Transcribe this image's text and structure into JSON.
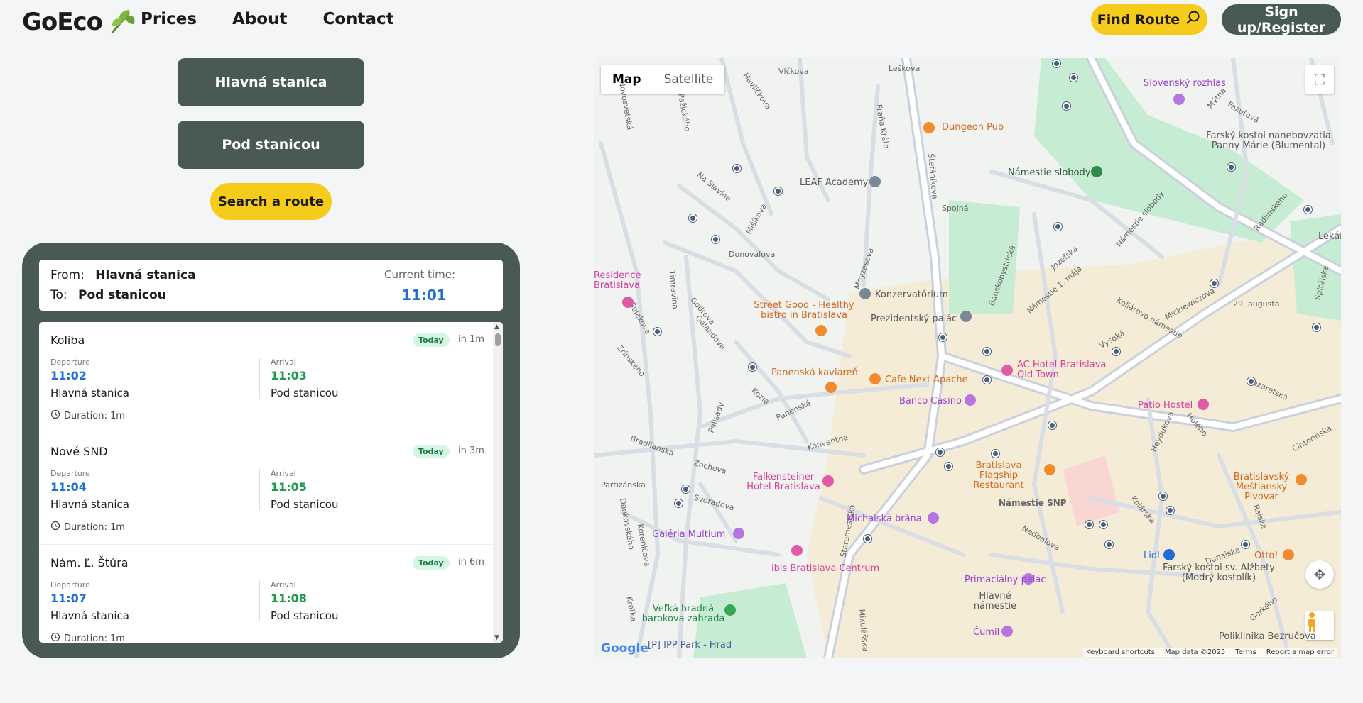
{
  "header": {
    "logo": "GoEco",
    "nav": [
      "Prices",
      "About",
      "Contact"
    ],
    "find_route": "Find Route",
    "signup": "Sign up/Register"
  },
  "route": {
    "from_button": "Hlavná stanica",
    "to_button": "Pod stanicou",
    "search_button": "Search a route"
  },
  "info": {
    "from_label": "From:",
    "from_value": "Hlavná stanica",
    "to_label": "To:",
    "to_value": "Pod stanicou",
    "current_time_label": "Current time:",
    "current_time": "11:01"
  },
  "departures": [
    {
      "line": "Koliba",
      "badge": "Today",
      "eta": "in 1m",
      "dep_label": "Departure",
      "dep_time": "11:02",
      "dep_stop": "Hlavná stanica",
      "arr_label": "Arrival",
      "arr_time": "11:03",
      "arr_stop": "Pod stanicou",
      "duration": "Duration: 1m"
    },
    {
      "line": "Nové SND",
      "badge": "Today",
      "eta": "in 3m",
      "dep_label": "Departure",
      "dep_time": "11:04",
      "dep_stop": "Hlavná stanica",
      "arr_label": "Arrival",
      "arr_time": "11:05",
      "arr_stop": "Pod stanicou",
      "duration": "Duration: 1m"
    },
    {
      "line": "Nám. Ľ. Štúra",
      "badge": "Today",
      "eta": "in 6m",
      "dep_label": "Departure",
      "dep_time": "11:07",
      "dep_stop": "Hlavná stanica",
      "arr_label": "Arrival",
      "arr_time": "11:08",
      "arr_stop": "Pod stanicou",
      "duration": "Duration: 1m"
    }
  ],
  "map": {
    "type_map": "Map",
    "type_satellite": "Satellite",
    "google": "Google",
    "attribution": [
      "Keyboard shortcuts",
      "Map data ©2025",
      "Terms",
      "Report a map error"
    ],
    "places": [
      {
        "name": "Slovenský rozhlas",
        "color": "#9b3fcf"
      },
      {
        "name": "Dungeon Pub",
        "color": "#d2691e"
      },
      {
        "name": "Námestie slobody",
        "color": "#2e5a3a"
      },
      {
        "name": "LEAF Academy",
        "color": "#555555"
      },
      {
        "name": "Farský kostol nanebovzatia Panny Márie (Blumental)",
        "color": "#555555"
      },
      {
        "name": "Residence Bratislava",
        "color": "#d63c9c"
      },
      {
        "name": "Konzervatórium",
        "color": "#555555"
      },
      {
        "name": "Street Good - Healthy bistro in Bratislava",
        "color": "#d2691e"
      },
      {
        "name": "Prezidentský palác",
        "color": "#555555"
      },
      {
        "name": "Panenská kaviareň",
        "color": "#d2691e"
      },
      {
        "name": "Cafe Next Apache",
        "color": "#d2691e"
      },
      {
        "name": "AC Hotel Bratislava Old Town",
        "color": "#d63c9c"
      },
      {
        "name": "Banco Casino",
        "color": "#9b3fcf"
      },
      {
        "name": "Patio Hostel",
        "color": "#d63c9c"
      },
      {
        "name": "Bratislava Flagship Restaurant",
        "color": "#d2691e"
      },
      {
        "name": "Falkensteiner Hotel Bratislava",
        "color": "#d63c9c"
      },
      {
        "name": "Bratislavský Meštiansky Pivovar",
        "color": "#d2691e"
      },
      {
        "name": "Michalská brána",
        "color": "#9b3fcf"
      },
      {
        "name": "Galéria Multium",
        "color": "#9b3fcf"
      },
      {
        "name": "ibis Bratislava Centrum",
        "color": "#d63c9c"
      },
      {
        "name": "Lidl",
        "color": "#1f6fd6"
      },
      {
        "name": "Otto!",
        "color": "#d2691e"
      },
      {
        "name": "Primaciálny palác",
        "color": "#9b3fcf"
      },
      {
        "name": "Hlavné námestie",
        "color": "#555555"
      },
      {
        "name": "Farský kostol sv. Alžbety (Modrý kostolík)",
        "color": "#555555"
      },
      {
        "name": "Veľká hradná barokova záhrada",
        "color": "#1e8a45"
      },
      {
        "name": "Čumil",
        "color": "#9b3fcf"
      },
      {
        "name": "[P] IPP Park - Hrad",
        "color": "#4a5f9a"
      },
      {
        "name": "Poliklinika Bezručova",
        "color": "#555555"
      },
      {
        "name": "Lekár",
        "color": "#555555"
      }
    ],
    "streets": [
      "Leškova",
      "Vlčkova",
      "Havlíčkova",
      "Fraňa Kráľa",
      "Štefánikova",
      "Mýtna",
      "Fazuľová",
      "Na Slavíne",
      "Spojná",
      "Radlinského",
      "Jozefská",
      "Námestie slobody",
      "Donovalova",
      "Moyzesova",
      "Banskobystrická",
      "Námestie 1. mája",
      "Kollárovo námestie",
      "Mickiewiczova",
      "29. augusta",
      "Spitálska",
      "Timravina",
      "Godrova",
      "Galandova",
      "Šulekova",
      "Zrínskeho",
      "Kozia",
      "Palisády",
      "Panenská",
      "Vysoká",
      "Konventná",
      "Lazaretská",
      "Holého",
      "Zochova",
      "Partizánska",
      "Svoradova",
      "Námestie SNP",
      "Heydukova",
      "Cintorínska",
      "Kolárska",
      "Staromestská",
      "Nedbalova",
      "Dunajská",
      "Rajská",
      "Kráľka",
      "Gorkého",
      "Mikulášska",
      "Bradlianska",
      "Novosvetská",
      "Pažického",
      "Mišíkova",
      "Dankovského",
      "Koreničova"
    ]
  }
}
